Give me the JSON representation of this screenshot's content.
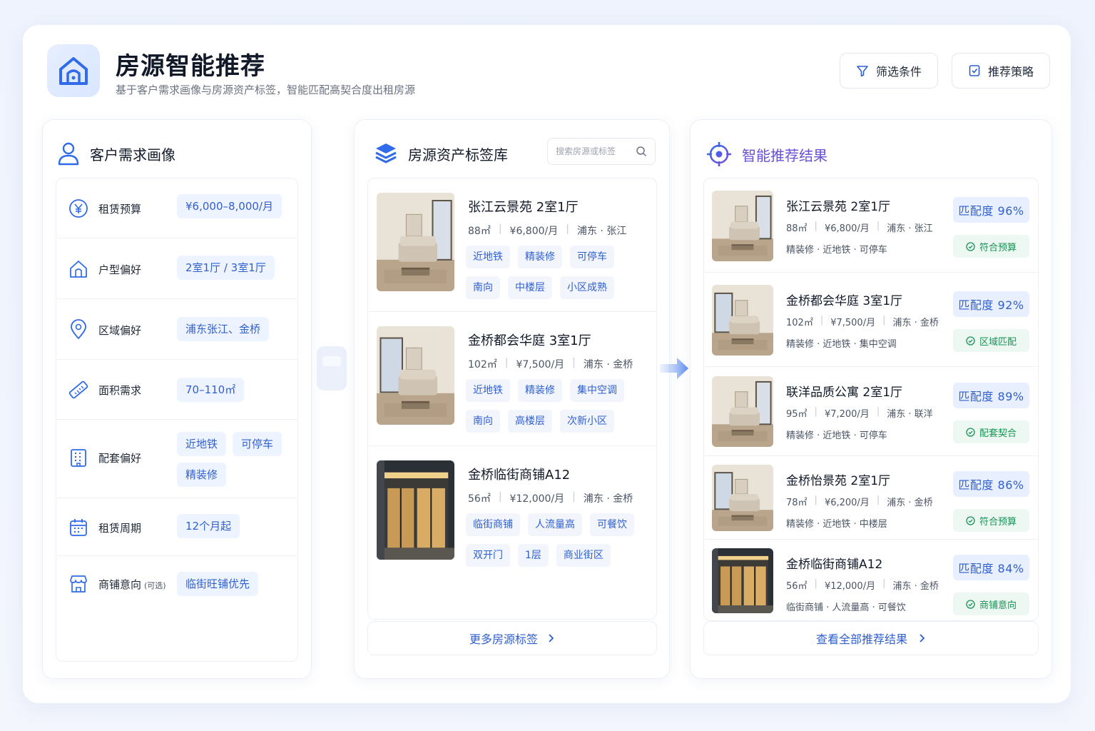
{
  "header": {
    "title": "房源智能推荐",
    "subtitle": "基于客户需求画像与房源资产标签，智能匹配高契合度出租房源",
    "filter_label": "筛选条件",
    "strategy_label": "推荐策略"
  },
  "colors": {
    "accent": "#2f5fd0",
    "accent_bg": "#eef4ff",
    "success": "#179456",
    "success_bg": "#ecf8f1",
    "purple": "#6a4fd8"
  },
  "profile": {
    "title": "客户需求画像",
    "items": [
      {
        "icon": "yen-icon",
        "label": "租赁预算",
        "note": "",
        "chips": [
          "¥6,000–8,000/月"
        ]
      },
      {
        "icon": "house-icon",
        "label": "户型偏好",
        "note": "",
        "chips": [
          "2室1厅 / 3室1厅"
        ]
      },
      {
        "icon": "location-pin-icon",
        "label": "区域偏好",
        "note": "",
        "chips": [
          "浦东张江、金桥"
        ]
      },
      {
        "icon": "ruler-icon",
        "label": "面积需求",
        "note": "",
        "chips": [
          "70–110㎡"
        ]
      },
      {
        "icon": "building-icon",
        "label": "配套偏好",
        "note": "",
        "chips": [
          "近地铁",
          "可停车",
          "精装修"
        ]
      },
      {
        "icon": "calendar-icon",
        "label": "租赁周期",
        "note": "",
        "chips": [
          "12个月起"
        ]
      },
      {
        "icon": "shop-icon",
        "label": "商铺意向",
        "note": "(可选)",
        "chips": [
          "临街旺铺优先"
        ]
      }
    ]
  },
  "assets": {
    "title": "房源资产标签库",
    "search_placeholder": "搜索房源或标签",
    "listings": [
      {
        "name": "张江云景苑  2室1厅",
        "area": "88㎡",
        "price": "¥6,800/月",
        "district": "浦东 · 张江",
        "tags": [
          "近地铁",
          "精装修",
          "可停车",
          "南向",
          "中楼层",
          "小区成熟"
        ]
      },
      {
        "name": "金桥都会华庭  3室1厅",
        "area": "102㎡",
        "price": "¥7,500/月",
        "district": "浦东 · 金桥",
        "tags": [
          "近地铁",
          "精装修",
          "集中空调",
          "南向",
          "高楼层",
          "次新小区"
        ]
      },
      {
        "name": "金桥临街商铺A12",
        "area": "56㎡",
        "price": "¥12,000/月",
        "district": "浦东 · 金桥",
        "tags": [
          "临街商铺",
          "人流量高",
          "可餐饮",
          "双开门",
          "1层",
          "商业街区"
        ]
      }
    ],
    "more_label": "更多房源标签"
  },
  "results": {
    "title": "智能推荐结果",
    "items": [
      {
        "name": "张江云景苑  2室1厅",
        "area": "88㎡",
        "price": "¥6,800/月",
        "district": "浦东 · 张江",
        "features": "精装修 · 近地铁 · 可停车",
        "score": "匹配度 96%",
        "reason": "符合预算",
        "kind": "apartment"
      },
      {
        "name": "金桥都会华庭  3室1厅",
        "area": "102㎡",
        "price": "¥7,500/月",
        "district": "浦东 · 金桥",
        "features": "精装修 · 近地铁 · 集中空调",
        "score": "匹配度 92%",
        "reason": "区域匹配",
        "kind": "apartment"
      },
      {
        "name": "联洋品质公寓  2室1厅",
        "area": "95㎡",
        "price": "¥7,200/月",
        "district": "浦东 · 联洋",
        "features": "精装修 · 近地铁 · 可停车",
        "score": "匹配度 89%",
        "reason": "配套契合",
        "kind": "apartment"
      },
      {
        "name": "金桥怡景苑  2室1厅",
        "area": "78㎡",
        "price": "¥6,200/月",
        "district": "浦东 · 金桥",
        "features": "精装修 · 近地铁 · 中楼层",
        "score": "匹配度 86%",
        "reason": "符合预算",
        "kind": "apartment"
      },
      {
        "name": "金桥临街商铺A12",
        "area": "56㎡",
        "price": "¥12,000/月",
        "district": "浦东 · 金桥",
        "features": "临街商铺 · 人流量高 · 可餐饮",
        "score": "匹配度 84%",
        "reason": "商铺意向",
        "kind": "shop"
      }
    ],
    "all_label": "查看全部推荐结果"
  }
}
